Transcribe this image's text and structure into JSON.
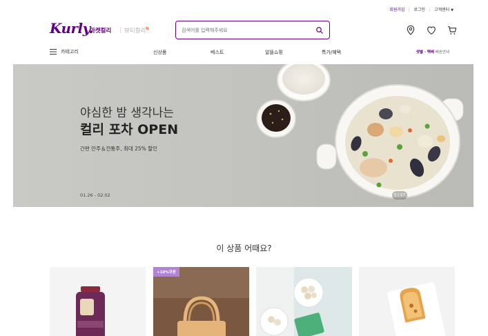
{
  "topbar": {
    "signup": "회원가입",
    "login": "로그인",
    "service": "고객센터"
  },
  "header": {
    "logo": "Kurly",
    "market_tab": "마켓컬리",
    "beauty_tab": "뷰티컬리",
    "beauty_badge": "N",
    "search_placeholder": "검색어를 입력해주세요"
  },
  "nav": {
    "category": "카테고리",
    "items": [
      "신상품",
      "베스트",
      "알뜰쇼핑",
      "특가/혜택"
    ],
    "delivery_highlight": "샛별 · 택배",
    "delivery_suffix": "배송안내"
  },
  "banner": {
    "line1": "야심한 밤 생각나는",
    "line2": "컬리 포차 OPEN",
    "line3": "간편 안주＆전통주, 최대 25% 할인",
    "date": "01.26 - 02.02",
    "pager": "5 / 17"
  },
  "section": {
    "title": "이 상품 어때요?",
    "coupon": "+10%쿠폰"
  },
  "colors": {
    "brand": "#5f0080",
    "coupon": "#b083d6"
  }
}
